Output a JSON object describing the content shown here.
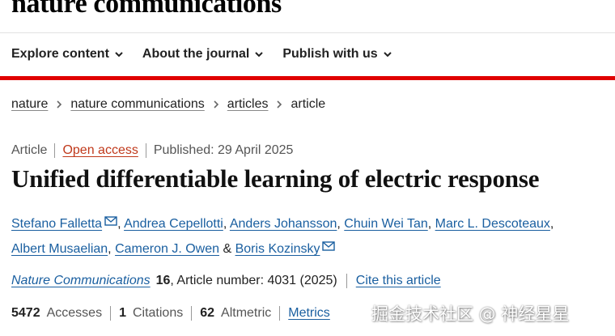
{
  "header": {
    "brand": "nature communications"
  },
  "nav": {
    "items": [
      {
        "label": "Explore content"
      },
      {
        "label": "About the journal"
      },
      {
        "label": "Publish with us"
      }
    ]
  },
  "breadcrumb": {
    "links": [
      "nature",
      "nature communications",
      "articles"
    ],
    "current": "article"
  },
  "article": {
    "type": "Article",
    "access": "Open access",
    "published": "Published: 29 April 2025",
    "title": "Unified differentiable learning of electric response",
    "authors": [
      "Stefano Falletta",
      "Andrea Cepellotti",
      "Anders Johansson",
      "Chuin Wei Tan",
      "Marc L. Descoteaux",
      "Albert Musaelian",
      "Cameron J. Owen",
      "Boris Kozinsky"
    ],
    "journal": "Nature Communications",
    "volume": "16",
    "article_number": ", Article number: 4031 (2025)",
    "cite_label": "Cite this article"
  },
  "metrics": {
    "accesses_value": "5472",
    "accesses_label": "Accesses",
    "citations_value": "1",
    "citations_label": "Citations",
    "altmetric_value": "62",
    "altmetric_label": "Altmetric",
    "metrics_link": "Metrics"
  },
  "watermark": "掘金技术社区 @ 神经星星",
  "colors": {
    "accent_red": "#e00000",
    "link_blue": "#1a5fa0",
    "open_access": "#c0391b"
  }
}
